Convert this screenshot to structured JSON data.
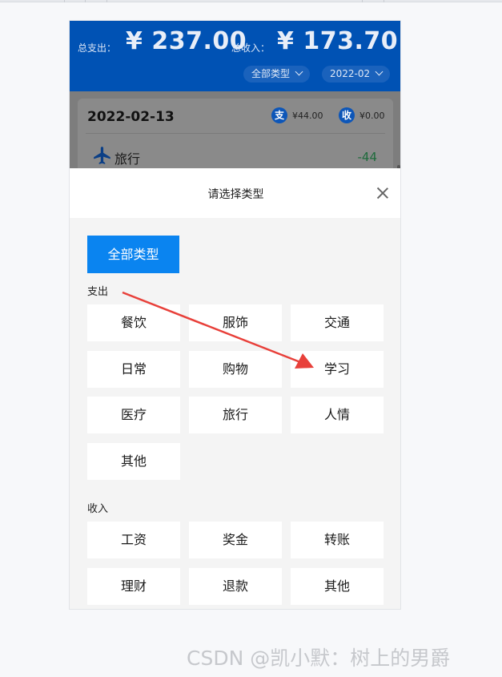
{
  "header": {
    "expense_label": "总支出：",
    "expense_value": "¥ 237.00",
    "income_label": "总收入：",
    "income_value": "¥ 173.70",
    "type_filter": "全部类型",
    "month_filter": "2022-02"
  },
  "record": {
    "date": "2022-02-13",
    "expense_badge": "支",
    "expense_amount": "¥44.00",
    "income_badge": "收",
    "income_amount": "¥0.00",
    "item_icon": "airplane-icon",
    "item_label": "旅行",
    "item_amount": "-44"
  },
  "sheet": {
    "title": "请选择类型",
    "all_types": "全部类型",
    "expense_section": "支出",
    "expense_types": [
      "餐饮",
      "服饰",
      "交通",
      "日常",
      "购物",
      "学习",
      "医疗",
      "旅行",
      "人情",
      "其他"
    ],
    "income_section": "收入",
    "income_types": [
      "工资",
      "奖金",
      "转账",
      "理财",
      "退款",
      "其他"
    ]
  },
  "colors": {
    "header_bg": "#0052b4",
    "accent": "#0a84f0",
    "arrow": "#e8403a"
  },
  "watermark": "CSDN @凯小默：树上的男爵"
}
